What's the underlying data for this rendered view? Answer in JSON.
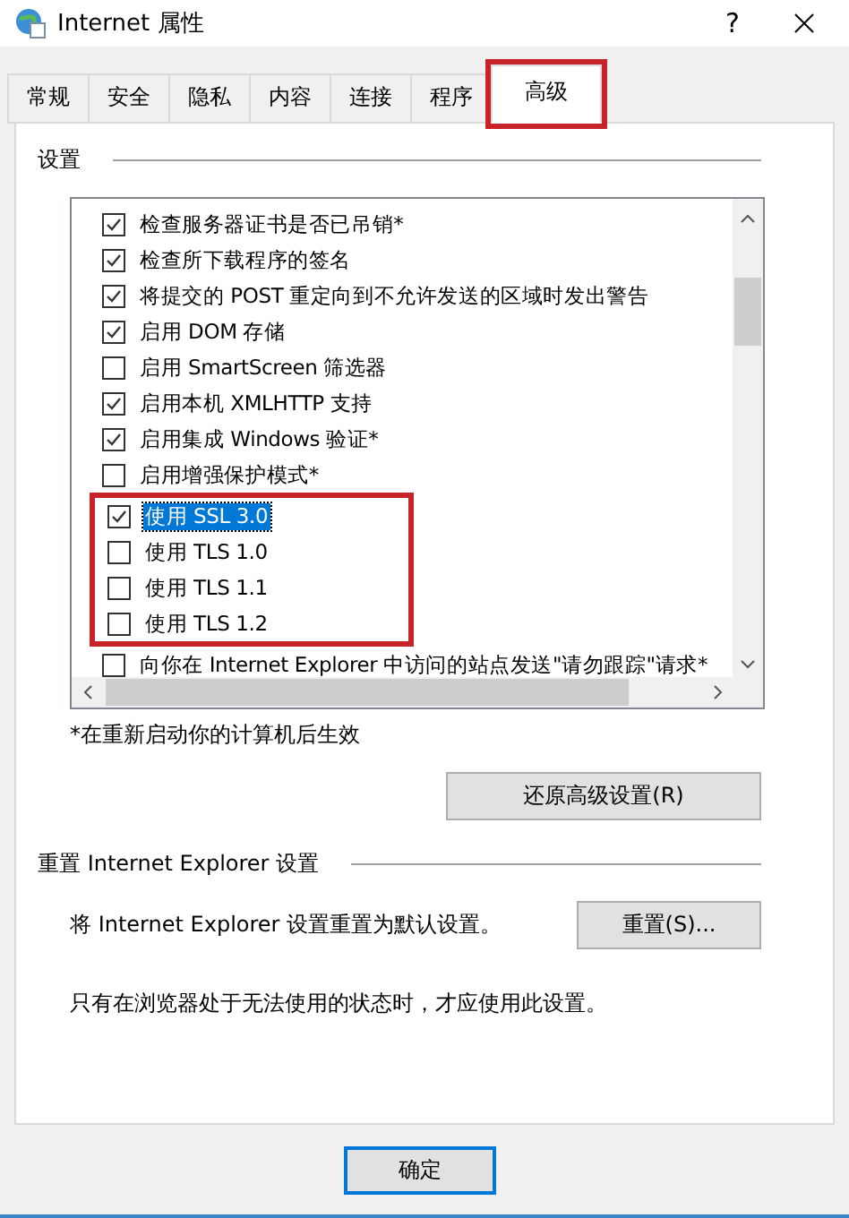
{
  "window": {
    "title": "Internet 属性",
    "help": "?"
  },
  "tabs": [
    {
      "label": "常规",
      "selected": false,
      "annotated": false
    },
    {
      "label": "安全",
      "selected": false,
      "annotated": false
    },
    {
      "label": "隐私",
      "selected": false,
      "annotated": false
    },
    {
      "label": "内容",
      "selected": false,
      "annotated": false
    },
    {
      "label": "连接",
      "selected": false,
      "annotated": false
    },
    {
      "label": "程序",
      "selected": false,
      "annotated": false
    },
    {
      "label": "高级",
      "selected": true,
      "annotated": true
    }
  ],
  "settings": {
    "title": "设置",
    "items": [
      {
        "label": "检查服务器证书是否已吊销*",
        "checked": true,
        "selected": false,
        "annotated": false
      },
      {
        "label": "检查所下载程序的签名",
        "checked": true,
        "selected": false,
        "annotated": false
      },
      {
        "label": "将提交的 POST 重定向到不允许发送的区域时发出警告",
        "checked": true,
        "selected": false,
        "annotated": false
      },
      {
        "label": "启用 DOM 存储",
        "checked": true,
        "selected": false,
        "annotated": false
      },
      {
        "label": "启用 SmartScreen 筛选器",
        "checked": false,
        "selected": false,
        "annotated": false
      },
      {
        "label": "启用本机 XMLHTTP 支持",
        "checked": true,
        "selected": false,
        "annotated": false
      },
      {
        "label": "启用集成 Windows 验证*",
        "checked": true,
        "selected": false,
        "annotated": false
      },
      {
        "label": "启用增强保护模式*",
        "checked": false,
        "selected": false,
        "annotated": false
      },
      {
        "label": "使用 SSL 3.0",
        "checked": true,
        "selected": true,
        "annotated": true
      },
      {
        "label": "使用 TLS 1.0",
        "checked": false,
        "selected": false,
        "annotated": true
      },
      {
        "label": "使用 TLS 1.1",
        "checked": false,
        "selected": false,
        "annotated": true
      },
      {
        "label": "使用 TLS 1.2",
        "checked": false,
        "selected": false,
        "annotated": true
      },
      {
        "label": "向你在 Internet Explorer 中访问的站点发送\"请勿跟踪\"请求*",
        "checked": false,
        "selected": false,
        "annotated": false
      }
    ],
    "note": "*在重新启动你的计算机后生效",
    "restore_button": "还原高级设置(R)"
  },
  "reset": {
    "title": "重置 Internet Explorer 设置",
    "description": "将 Internet Explorer 设置重置为默认设置。",
    "button": "重置(S)...",
    "warning": "只有在浏览器处于无法使用的状态时，才应使用此设置。"
  },
  "buttons": [
    {
      "label": "确定",
      "default": true
    }
  ]
}
